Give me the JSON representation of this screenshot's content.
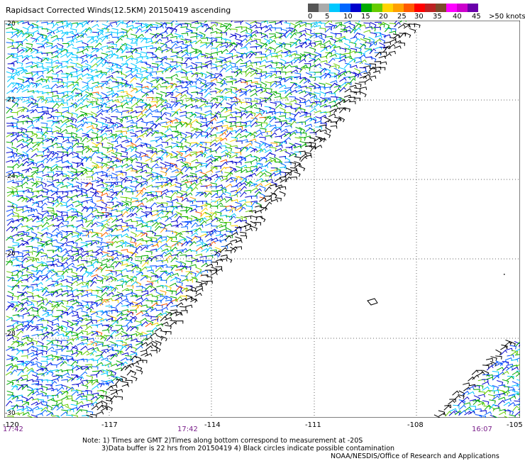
{
  "title": "Rapidsact Corrected Winds(12.5KM) 20150419 ascending",
  "legend": {
    "colors": [
      "#555555",
      "#aaaaaa",
      "#00c8ff",
      "#0066ff",
      "#0000cc",
      "#00aa00",
      "#66cc00",
      "#ffd400",
      "#ffa000",
      "#ff5a00",
      "#ff0000",
      "#bb2222",
      "#7b4a2a",
      "#ff00ff",
      "#cc00cc",
      "#6a00aa"
    ],
    "ticks": [
      "0",
      "5",
      "10",
      "15",
      "20",
      "25",
      "30",
      "35",
      "40",
      "45",
      ">50 knots"
    ]
  },
  "map": {
    "lat_labels": [
      "-20",
      "-22",
      "-24",
      "-26",
      "-28",
      "-30"
    ],
    "lon_labels": [
      "-120",
      "-117",
      "-114",
      "-111",
      "-108",
      "-105"
    ],
    "time_labels": [
      "17:42",
      "17:42",
      "16:07"
    ]
  },
  "notes": {
    "line1": "Note: 1) Times are GMT 2)Times along bottom correspond to measurement at -20S",
    "line2": "3)Data buffer is 22 hrs from 20150419 4) Black circles indicate possible contamination"
  },
  "credit": "NOAA/NESDIS/Office of Research and Applications"
}
